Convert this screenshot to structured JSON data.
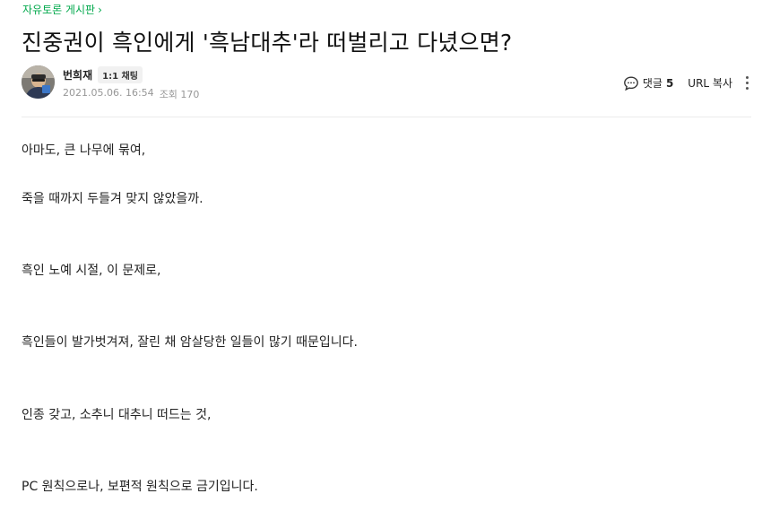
{
  "board": {
    "name": "자유토론 게시판",
    "chevron": "›"
  },
  "post": {
    "title": "진중권이 흑인에게 '흑남대추'라 떠벌리고 다녔으면?",
    "author": "번희재",
    "chat_label": "1:1 채팅",
    "date": "2021.05.06. 16:54",
    "views_label": "조회 170"
  },
  "toolbar": {
    "comment_label": "댓글",
    "comment_count": "5",
    "url_copy_label": "URL 복사",
    "comment_icon": "speech-bubble-icon",
    "more_icon": "vertical-dots-icon"
  },
  "body": {
    "paragraphs": [
      "아마도, 큰 나무에 묶여,",
      "죽을 때까지 두들겨 맞지 않았을까.",
      "흑인 노예 시절, 이 문제로,",
      "흑인들이 발가벗겨져, 잘린 채 암살당한 일들이 많기 때문입니다.",
      "인종 갖고, 소추니 대추니 떠드는 것,",
      "PC 원칙으로나, 보편적 원칙으로 금기입니다."
    ]
  },
  "colors": {
    "board_link": "#03a94d",
    "meta_text": "#979797",
    "divider": "#ebebeb"
  }
}
